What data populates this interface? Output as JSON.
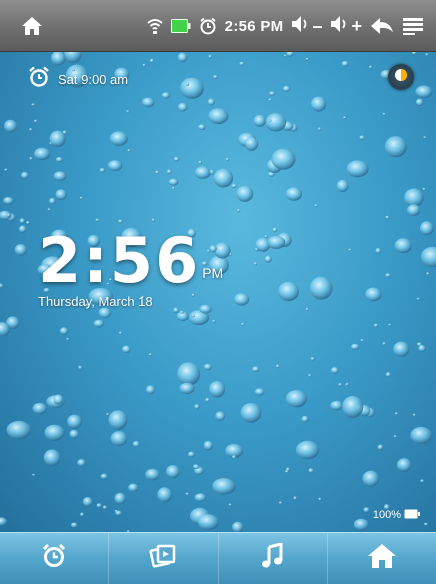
{
  "status_bar": {
    "time": "2:56 PM",
    "icons": [
      "home-icon",
      "wifi-icon",
      "battery-icon",
      "alarm-icon",
      "volume-down-icon",
      "volume-up-icon",
      "back-icon",
      "menu-icon"
    ],
    "volume_down_sign": "–",
    "volume_up_sign": "+"
  },
  "home_screen": {
    "alarm_text": "Sat 9:00 am",
    "clock_time": "2:56",
    "clock_ampm": "PM",
    "clock_date": "Thursday, March 18",
    "battery_text": "100%"
  },
  "dock": {
    "items": [
      "alarm-clock-icon",
      "photo-icon",
      "music-icon",
      "home-icon"
    ]
  },
  "colors": {
    "status_bar": "#6f6f6f",
    "wallpaper_accent": "#3b9bc8",
    "dock": "#55a6cc"
  }
}
